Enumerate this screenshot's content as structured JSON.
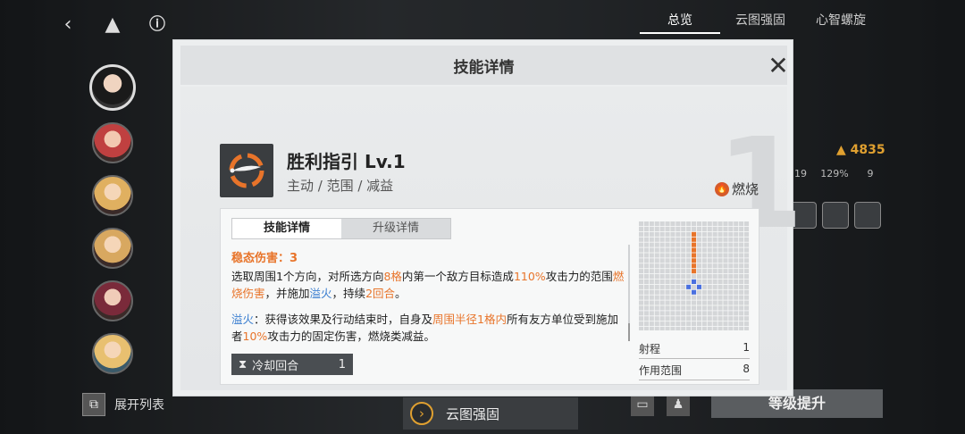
{
  "top_tabs": [
    "总览",
    "云图强固",
    "心智螺旋"
  ],
  "bottom": {
    "expand_label": "展开列表",
    "level_up_label": "等级提升"
  },
  "background_stats": {
    "power": "4835",
    "stat1": "19",
    "stat2": "129%",
    "stat3": "9"
  },
  "modal": {
    "title": "技能详情",
    "skill_name": "胜利指引 Lv.1",
    "skill_tags": "主动 / 范围 / 减益",
    "element_tag": "燃烧",
    "big_level_digit": "1",
    "tabs": [
      "技能详情",
      "升级详情"
    ],
    "steady_damage": "稳态伤害：3",
    "description": {
      "p1": [
        {
          "t": "选取周围1个方向，对所选方向",
          "c": ""
        },
        {
          "t": "8格",
          "c": "o"
        },
        {
          "t": "内第一个敌方目标造成",
          "c": ""
        },
        {
          "t": "110%",
          "c": "o"
        },
        {
          "t": "攻击力的范围",
          "c": ""
        },
        {
          "t": "燃烧伤害",
          "c": "o"
        },
        {
          "t": "，并施加",
          "c": ""
        },
        {
          "t": "溢火",
          "c": "b"
        },
        {
          "t": "，持续",
          "c": ""
        },
        {
          "t": "2回合",
          "c": "o"
        },
        {
          "t": "。",
          "c": ""
        }
      ],
      "p2": [
        {
          "t": "溢火",
          "c": "b"
        },
        {
          "t": "：获得该效果及行动结束时，自身及",
          "c": ""
        },
        {
          "t": "周围半径1格内",
          "c": "o"
        },
        {
          "t": "所有友方单位受到施加者",
          "c": ""
        },
        {
          "t": "10%",
          "c": "o"
        },
        {
          "t": "攻击力的固定伤害，燃烧类减益。",
          "c": ""
        }
      ]
    },
    "cooldown_label": "冷却回合",
    "cooldown_value": "1",
    "range_label": "射程",
    "range_value": "1",
    "area_label": "作用范围",
    "area_value": "8",
    "cloud_button_label": "云图强固"
  },
  "colors": {
    "orange": "#e8742a",
    "blue": "#3a7ed0",
    "grid_blue": "#4a70e0"
  }
}
